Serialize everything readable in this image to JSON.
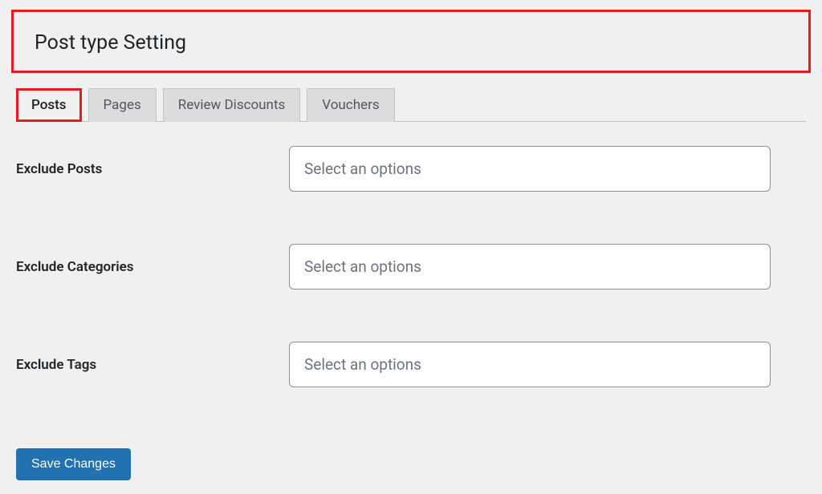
{
  "header": {
    "title": "Post type Setting"
  },
  "tabs": [
    {
      "label": "Posts",
      "active": true
    },
    {
      "label": "Pages",
      "active": false
    },
    {
      "label": "Review Discounts",
      "active": false
    },
    {
      "label": "Vouchers",
      "active": false
    }
  ],
  "form": {
    "rows": [
      {
        "label": "Exclude Posts",
        "placeholder": "Select an options"
      },
      {
        "label": "Exclude Categories",
        "placeholder": "Select an options"
      },
      {
        "label": "Exclude Tags",
        "placeholder": "Select an options"
      }
    ]
  },
  "buttons": {
    "save": "Save Changes"
  },
  "colors": {
    "highlight": "#e11d1d",
    "primary": "#2271b1",
    "bg": "#f0f0f1"
  }
}
